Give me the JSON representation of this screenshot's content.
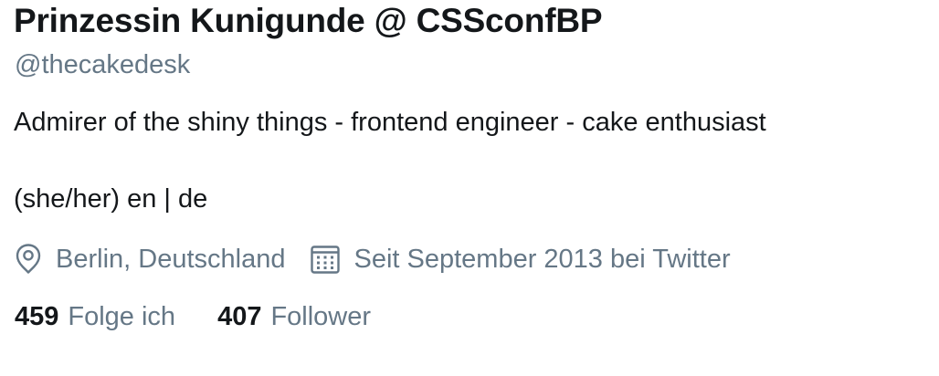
{
  "profile": {
    "display_name": "Prinzessin Kunigunde @ CSSconfBP",
    "handle": "@thecakedesk",
    "bio_line_1": "Admirer of the shiny things - frontend engineer - cake enthusiast",
    "bio_line_2": "(she/her) en | de"
  },
  "meta": {
    "location_icon": "location-pin-icon",
    "location": "Berlin, Deutschland",
    "joined_icon": "calendar-icon",
    "joined": "Seit September 2013 bei Twitter"
  },
  "stats": {
    "following_count": "459",
    "following_label": "Folge ich",
    "followers_count": "407",
    "followers_label": "Follower"
  },
  "colors": {
    "primary_text": "#14171a",
    "secondary_text": "#657786",
    "background": "#ffffff"
  }
}
